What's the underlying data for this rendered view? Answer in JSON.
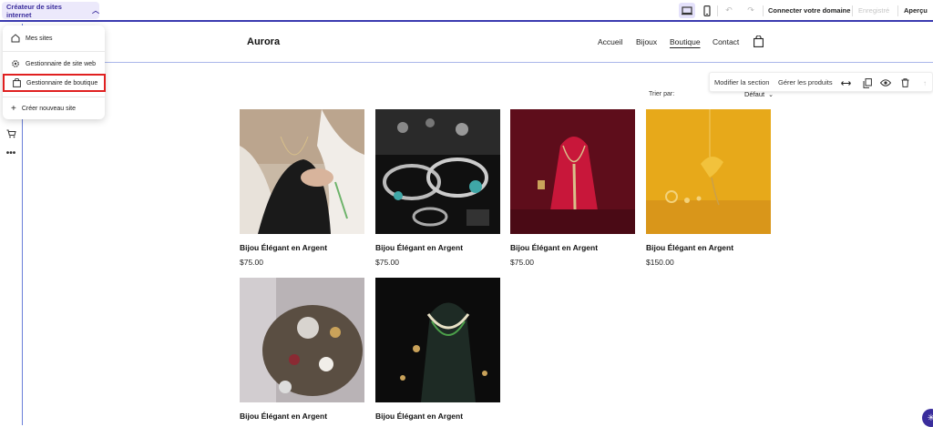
{
  "topbar": {
    "builder_label": "Créateur de sites internet",
    "connect_domain": "Connecter votre domaine",
    "saved": "Enregistré",
    "preview": "Aperçu"
  },
  "dropdown": {
    "items": [
      {
        "label": "Mes sites",
        "icon": "home-icon"
      },
      {
        "label": "Gestionnaire de site web",
        "icon": "gear-icon"
      },
      {
        "label": "Gestionnaire de boutique",
        "icon": "shopping-bag-icon"
      },
      {
        "label": "Créer nouveau site",
        "icon": "plus-icon"
      }
    ]
  },
  "site": {
    "logo": "Aurora",
    "nav": [
      "Accueil",
      "Bijoux",
      "Boutique",
      "Contact"
    ],
    "active_nav": "Boutique"
  },
  "section_toolbar": {
    "edit_section": "Modifier la section",
    "manage_products": "Gérer les produits"
  },
  "sort": {
    "label": "Trier par:",
    "selected": "Défaut"
  },
  "products": [
    {
      "name": "Bijou Élégant en Argent",
      "price": "$75.00"
    },
    {
      "name": "Bijou Élégant en Argent",
      "price": "$75.00"
    },
    {
      "name": "Bijou Élégant en Argent",
      "price": "$75.00"
    },
    {
      "name": "Bijou Élégant en Argent",
      "price": "$150.00"
    },
    {
      "name": "Bijou Élégant en Argent",
      "price": ""
    },
    {
      "name": "Bijou Élégant en Argent",
      "price": ""
    }
  ],
  "colors": {
    "accent": "#3a2d9c",
    "highlight": "#e02020"
  }
}
